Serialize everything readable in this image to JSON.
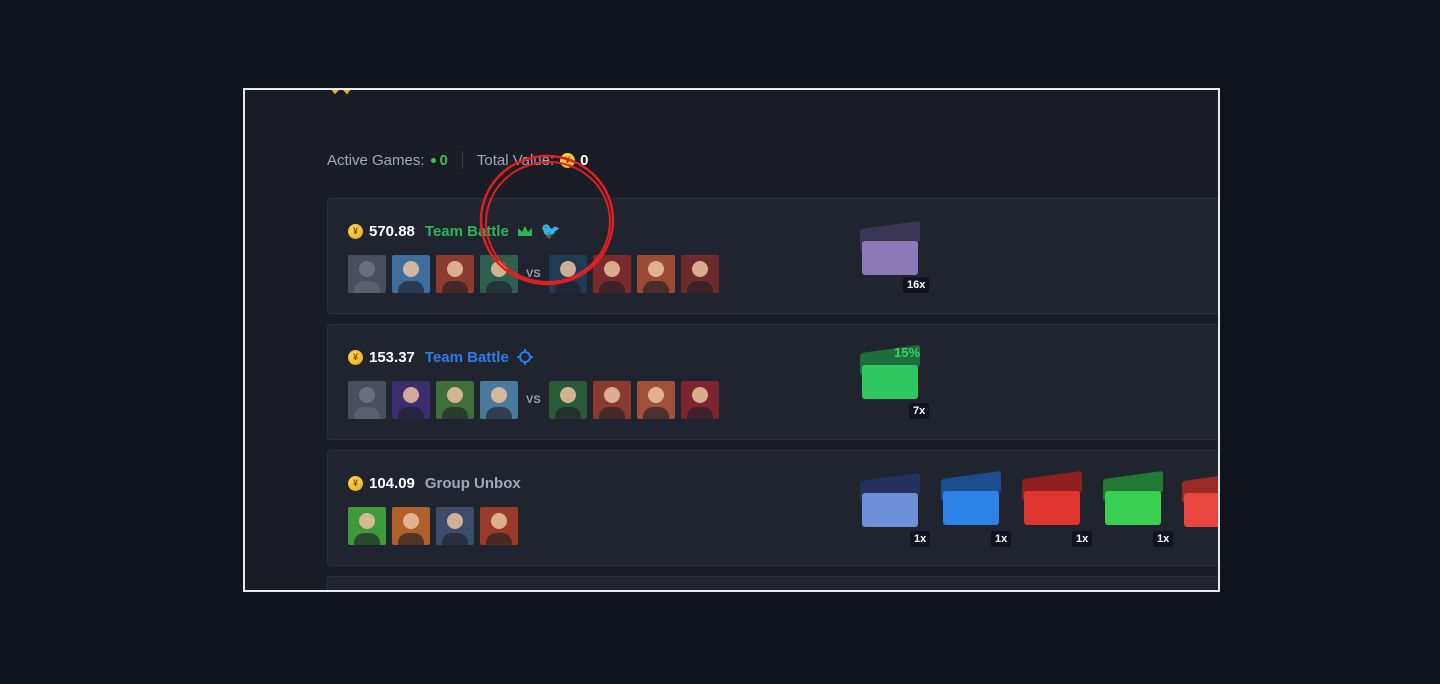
{
  "stats": {
    "active_label": "Active Games:",
    "active_value": "0",
    "total_label": "Total Value:",
    "total_value": "0"
  },
  "games": [
    {
      "price": "570.88",
      "mode": "Team Battle",
      "mode_color": "#2fb559",
      "icons": [
        "crown-icon",
        "bird-icon"
      ],
      "vs": "VS",
      "boxes": [
        {
          "qty": "16x",
          "color": "#8c7ab8"
        }
      ]
    },
    {
      "price": "153.37",
      "mode": "Team Battle",
      "mode_color": "#2d7ce8",
      "icons": [
        "crosshair-icon"
      ],
      "vs": "VS",
      "boxes": [
        {
          "qty": "7x",
          "color": "#2fc760",
          "badge": "15%"
        }
      ]
    },
    {
      "price": "104.09",
      "mode": "Group Unbox",
      "mode_color": "#a3a8b8",
      "icons": [],
      "boxes": [
        {
          "qty": "1x",
          "color": "#6f8fd9"
        },
        {
          "qty": "1x",
          "color": "#2c82e6"
        },
        {
          "qty": "1x",
          "color": "#e0352f"
        },
        {
          "qty": "1x",
          "color": "#3bcf52"
        },
        {
          "qty": "",
          "color": "#e8463e"
        }
      ]
    }
  ]
}
